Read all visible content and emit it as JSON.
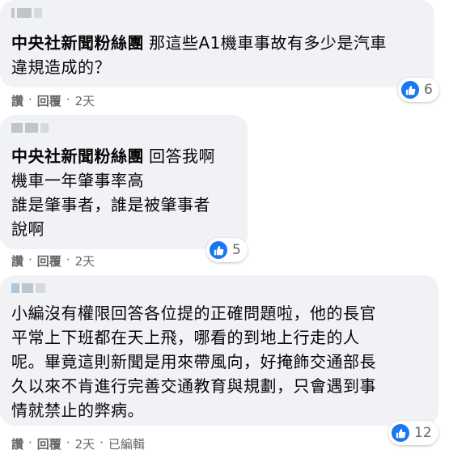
{
  "colors": {
    "bubble": "#f0f2f5",
    "like_blue": "#1877f2",
    "meta_gray": "#65676b"
  },
  "comments": [
    {
      "author": "中央社新聞粉絲團",
      "body_lines": [
        "那這些A1機車事故有多少是汽車",
        "違規造成的？"
      ],
      "reaction_icon": "like-icon",
      "reactions": "6",
      "actions": {
        "like": "讚",
        "sep1": "·",
        "reply": "回覆",
        "sep2": "·",
        "time": "2天"
      }
    },
    {
      "author": "中央社新聞粉絲團",
      "body_lines": [
        "回答我啊",
        "機車一年肇事率高",
        "誰是肇事者，誰是被肇事者",
        "說啊"
      ],
      "reaction_icon": "like-icon",
      "reactions": "5",
      "actions": {
        "like": "讚",
        "sep1": "·",
        "reply": "回覆",
        "sep2": "·",
        "time": "2天"
      }
    },
    {
      "author": "",
      "body_lines": [
        "小編沒有權限回答各位提的正確問題啦，他的長官",
        "平常上下班都在天上飛，哪看的到地上行走的人",
        "呢。畢竟這則新聞是用來帶風向，好掩飾交通部長",
        "久以來不肯進行完善交通教育與規劃，只會遇到事",
        "情就禁止的弊病。"
      ],
      "reaction_icon": "like-icon",
      "reactions": "12",
      "actions": {
        "like": "讚",
        "sep1": "·",
        "reply": "回覆",
        "sep2": "·",
        "time": "2天",
        "sep3": "·",
        "edited": "已編輯"
      }
    }
  ]
}
